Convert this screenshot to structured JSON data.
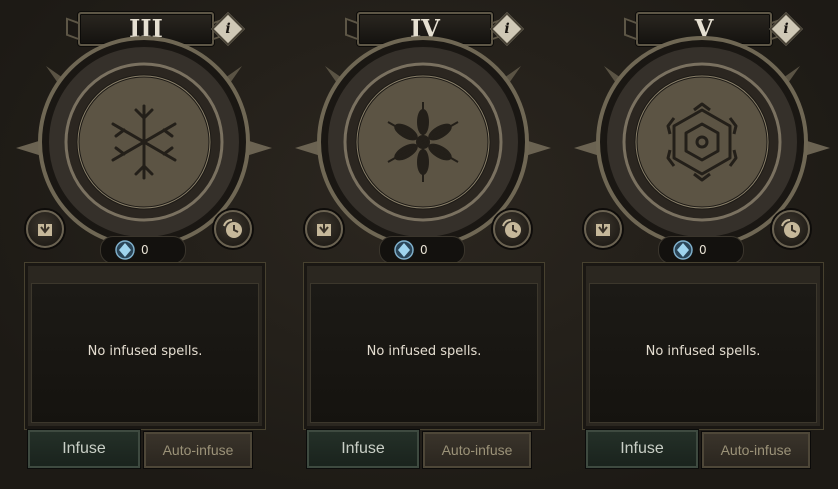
{
  "panels": [
    {
      "numeral": "III",
      "info_icon": "i",
      "glyph": "snowflake-branch-icon",
      "counter": "0",
      "empty_text": "No infused spells.",
      "infuse_label": "Infuse",
      "auto_label": "Auto-infuse"
    },
    {
      "numeral": "IV",
      "info_icon": "i",
      "glyph": "snowflake-flower-icon",
      "counter": "0",
      "empty_text": "No infused spells.",
      "infuse_label": "Infuse",
      "auto_label": "Auto-infuse"
    },
    {
      "numeral": "V",
      "info_icon": "i",
      "glyph": "snowflake-hexagon-icon",
      "counter": "0",
      "empty_text": "No infused spells.",
      "infuse_label": "Infuse",
      "auto_label": "Auto-infuse"
    }
  ],
  "colors": {
    "background": "#231f19",
    "frame_metal": "#6b6352",
    "text_light": "#e4ddd0",
    "infuse_green": "#243028",
    "auto_disabled_text": "#9b9278"
  }
}
